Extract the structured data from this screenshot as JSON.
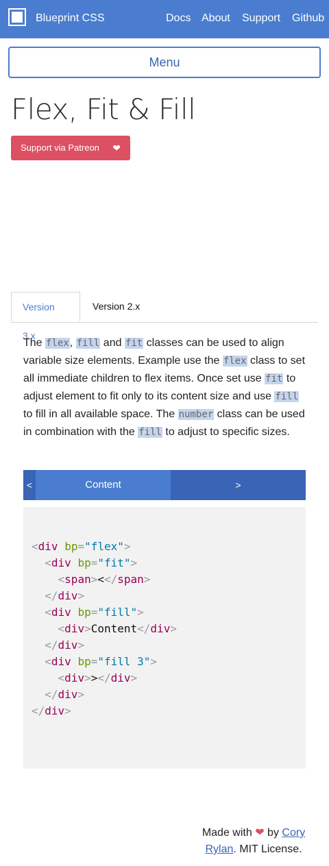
{
  "nav": {
    "brand": "Blueprint CSS",
    "links": [
      "Docs",
      "About",
      "Support",
      "Github"
    ]
  },
  "menu_label": "Menu",
  "page": {
    "title": "Flex, Fit & Fill",
    "patreon_label": "Support via Patreon"
  },
  "tabs": [
    "Version 3.x",
    "Version 2.x"
  ],
  "description": {
    "t1": "The ",
    "c1": "flex",
    "t2": ", ",
    "c2": "fill",
    "t3": " and ",
    "c3": "fit",
    "t4": " classes can be used to align variable size elements. Example use the ",
    "c4": "flex",
    "t5": " class to set all immediate children to flex items. Once set use ",
    "c5": "fit",
    "t6": " to adjust element to fit only to its content size and use ",
    "c6": "fill",
    "t7": " to fill in all available space. The ",
    "c7": "number",
    "t8": " class can be used in combination with the ",
    "c8": "fill",
    "t9": " to adjust to specific sizes."
  },
  "demo": {
    "left": "<",
    "middle": "Content",
    "right": ">"
  },
  "code": {
    "tag_div": "div",
    "tag_span": "span",
    "attr": "bp",
    "val_flex": "\"flex\"",
    "val_fit": "\"fit\"",
    "val_fill": "\"fill\"",
    "val_fill3": "\"fill 3\"",
    "text_lt": "<",
    "text_content": "Content",
    "text_gt": ">"
  },
  "footer": {
    "made_with": "Made with",
    "by": "by",
    "author": "Cory Rylan",
    "license": ". MIT License."
  },
  "colors": {
    "primary": "#4a7dcf",
    "primary_dark": "#3a64b5",
    "patreon": "#dd4f63",
    "code_bg": "#f2f2f2"
  },
  "icons": {
    "logo": "square-logo-icon",
    "heart": "heart-icon"
  }
}
